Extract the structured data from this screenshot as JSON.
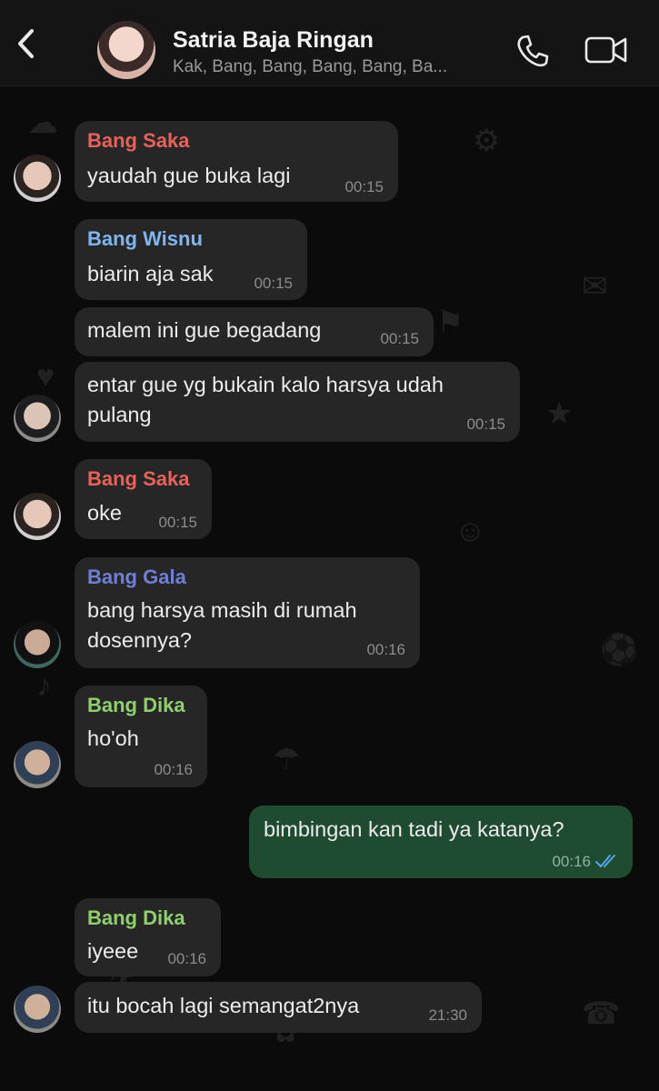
{
  "header": {
    "title": "Satria Baja Ringan",
    "subtitle": "Kak, Bang, Bang, Bang, Bang, Ba...",
    "icons": [
      "back-icon",
      "phone-icon",
      "video-camera-icon"
    ]
  },
  "colors": {
    "bang_saka": "#e8615a",
    "bang_wisnu": "#7fb6ef",
    "bang_gala": "#6f7fd6",
    "bang_dika": "#8ed06a",
    "incoming_bubble": "#262626",
    "outgoing_bubble": "#1f4b31",
    "read_ticks": "#53a6f0"
  },
  "messages": [
    {
      "sender": "Bang Saka",
      "text": "yaudah gue buka lagi",
      "time": "00:15"
    },
    {
      "sender": "Bang Wisnu",
      "text": "biarin aja sak",
      "time": "00:15"
    },
    {
      "text": "malem ini gue begadang",
      "time": "00:15"
    },
    {
      "text_line1": "entar gue yg bukain kalo harsya udah",
      "text_line2": "pulang",
      "time": "00:15"
    },
    {
      "sender": "Bang Saka",
      "text": "oke",
      "time": "00:15"
    },
    {
      "sender": "Bang Gala",
      "text_line1": "bang harsya masih di rumah",
      "text_line2": "dosennya?",
      "time": "00:16"
    },
    {
      "sender": "Bang Dika",
      "text": "ho'oh",
      "time": "00:16"
    },
    {
      "outgoing": true,
      "text": "bimbingan kan tadi ya katanya?",
      "time": "00:16",
      "status": "read"
    },
    {
      "sender": "Bang Dika",
      "text": "iyeee",
      "time": "00:16"
    },
    {
      "text": "itu bocah lagi semangat2nya",
      "time": "21:30"
    }
  ]
}
